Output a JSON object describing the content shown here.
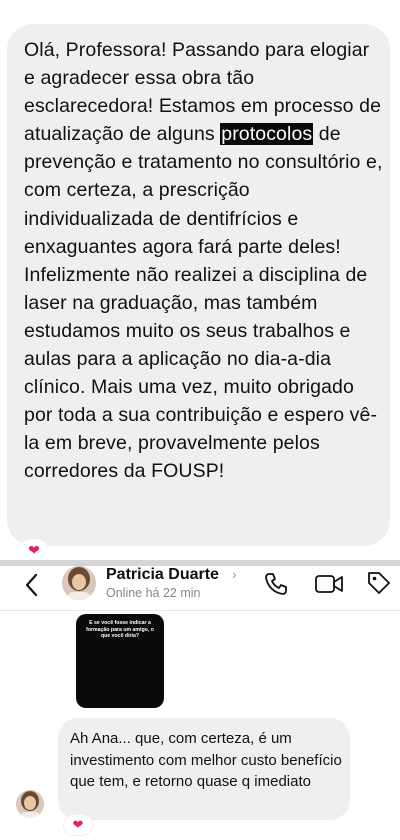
{
  "top_message": {
    "before": "Olá, Professora! Passando para elogiar e agradecer essa obra tão esclarecedora! Estamos em processo de atualização de alguns ",
    "highlight": "protocolos",
    "after": " de prevenção e tratamento no consultório e, com certeza, a prescrição individualizada de dentifrícios e enxaguantes agora fará parte deles! Infelizmente não realizei a disciplina de laser na graduação, mas também estudamos muito os seus trabalhos e aulas para a aplicação no dia-a-dia clínico. Mais uma vez, muito obrigado por toda a sua contribuição e espero vê-la em breve, provavelmente pelos corredores da FOUSP!",
    "reaction": "❤"
  },
  "header": {
    "name": "Patricia Duarte",
    "chevron": "›",
    "status": "Online há 22 min",
    "icons": [
      "back-icon",
      "phone-icon",
      "video-icon",
      "tag-icon"
    ]
  },
  "story": {
    "text": "E se você fosse indicar a formação para um amigo, o que você diria?"
  },
  "bottom_message": {
    "text": "Ah Ana... que, com certeza, é um investimento com melhor custo benefício que tem, e retorno quase q imediato",
    "reaction": "❤"
  },
  "colors": {
    "bubble": "#efeff1",
    "heart": "#e0245e"
  }
}
